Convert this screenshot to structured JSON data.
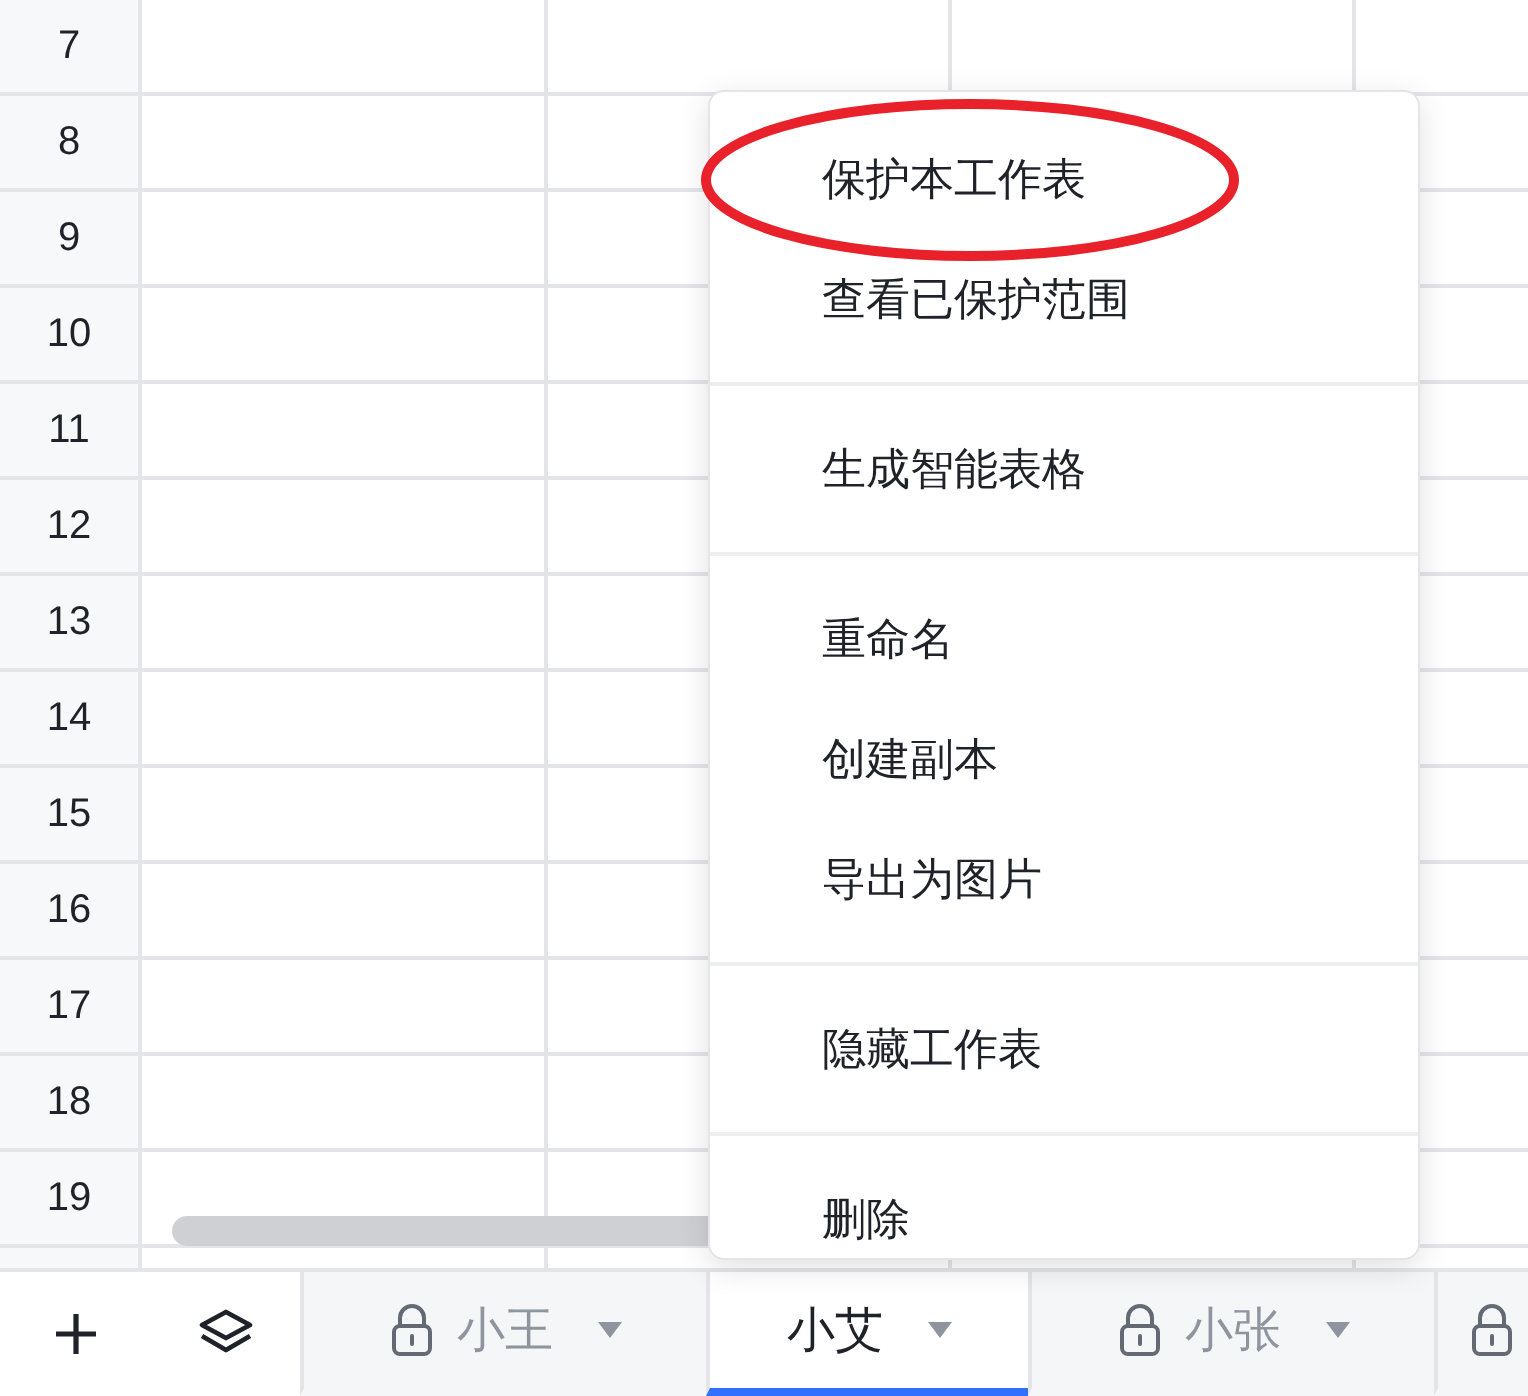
{
  "grid": {
    "row_numbers": [
      "7",
      "8",
      "9",
      "10",
      "11",
      "12",
      "13",
      "14",
      "15",
      "16",
      "17",
      "18",
      "19"
    ]
  },
  "menu": {
    "groups": [
      [
        {
          "label": "保护本工作表",
          "circled": true
        },
        {
          "label": "查看已保护范围",
          "circled": false
        }
      ],
      [
        {
          "label": "生成智能表格",
          "circled": false
        }
      ],
      [
        {
          "label": "重命名",
          "circled": false
        },
        {
          "label": "创建副本",
          "circled": false
        },
        {
          "label": "导出为图片",
          "circled": false
        }
      ],
      [
        {
          "label": "隐藏工作表",
          "circled": false
        }
      ],
      [
        {
          "label": "删除",
          "circled": false
        }
      ]
    ]
  },
  "sheet_tabs": [
    {
      "label": "小王",
      "locked": true,
      "selected": false
    },
    {
      "label": "小艾",
      "locked": false,
      "selected": true
    },
    {
      "label": "小张",
      "locked": true,
      "selected": false
    },
    {
      "locked": true,
      "selected": false
    }
  ]
}
